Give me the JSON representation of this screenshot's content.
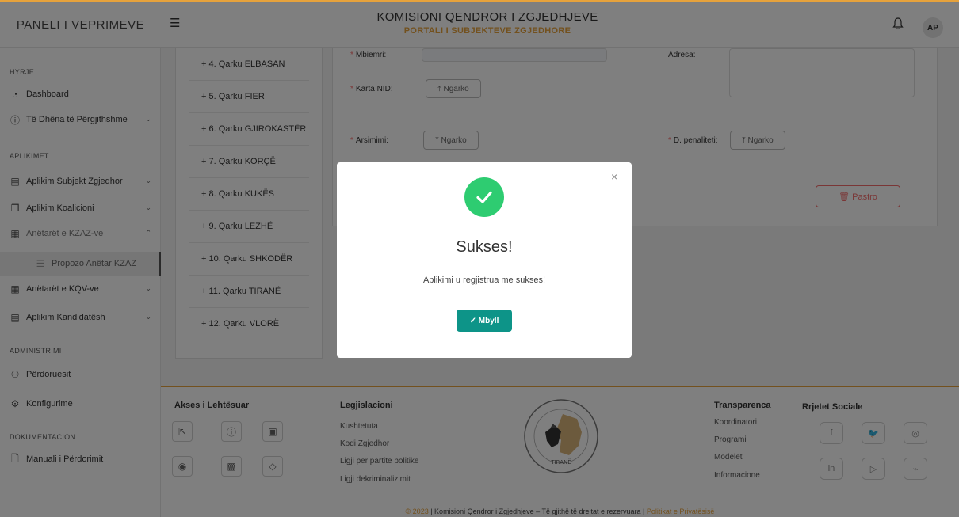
{
  "header": {
    "brand": "PANELI I VEPRIMEVE",
    "collapse_icon": "☰",
    "title": "KOMISIONI QENDROR I ZGJEDHJEVE",
    "subtitle": "PORTALI I SUBJEKTEVE ZGJEDHORE",
    "avatar": "AP",
    "accent_color": "#e6a23c"
  },
  "sidebar": {
    "sections": {
      "hyrje": "HYRJE",
      "aplikimet": "APLIKIMET",
      "administrimi": "ADMINISTRIMI",
      "dokumentacion": "DOKUMENTACION"
    },
    "items": [
      {
        "label": "Dashboard",
        "icon": "◔"
      },
      {
        "label": "Të Dhëna të Përgjithshme",
        "icon": "ⓘ"
      },
      {
        "label": "Aplikim Subjekt Zgjedhor",
        "icon": "▤"
      },
      {
        "label": "Aplikim Koalicioni",
        "icon": "❐"
      },
      {
        "label": "Anëtarët e KZAZ-ve",
        "icon": "▦"
      },
      {
        "label": "Propozo Anëtar KZAZ",
        "icon": "☰"
      },
      {
        "label": "Anëtarët e KQV-ve",
        "icon": "▦"
      },
      {
        "label": "Aplikim Kandidatësh",
        "icon": "▤"
      },
      {
        "label": "Përdoruesit",
        "icon": "⚇"
      },
      {
        "label": "Konfigurime",
        "icon": "⚙"
      },
      {
        "label": "Manuali i Përdorimit",
        "icon": "🗋"
      }
    ]
  },
  "qarqet": [
    "+ 4. Qarku ELBASAN",
    "+ 5. Qarku FIER",
    "+ 6. Qarku GJIROKASTËR",
    "+ 7. Qarku KORÇË",
    "+ 8. Qarku KUKËS",
    "+ 9. Qarku LEZHË",
    "+ 10. Qarku SHKODËR",
    "+ 11. Qarku TIRANË",
    "+ 12. Qarku VLORË"
  ],
  "form": {
    "mbiemri": "Mbiemri",
    "adresa": "Adresa",
    "karta_nid": "Karta NID",
    "arsimimi": "Arsimimi",
    "d_penaliteti": "D. penaliteti",
    "upload": "⤒ Ngarko",
    "pastro": "🗑 Pastro"
  },
  "modal": {
    "close": "×",
    "title": "Sukses!",
    "message": "Aplikimi u regjistrua me sukses!",
    "button": "✓  Mbyll"
  },
  "footer": {
    "akses_title": "Akses i Lehtësuar",
    "legj_title": "Legjislacioni",
    "legj_links": [
      "Kushtetuta",
      "Kodi Zgjedhor",
      "Ligji për partitë politike",
      "Ligji dekriminalizimit"
    ],
    "transp_title": "Transparenca",
    "transp_links": [
      "Koordinatori",
      "Programi",
      "Modelet",
      "Informacione"
    ],
    "social_title": "Rrjetet Sociale",
    "seal_city": "TIRANË",
    "copyright_year": "© 2023",
    "copyright_text": "|  Komisioni Qendror i Zgjedhjeve – Të gjithë të drejtat e rezervuara  |",
    "privacy": "Politikat e Privatësisë"
  }
}
